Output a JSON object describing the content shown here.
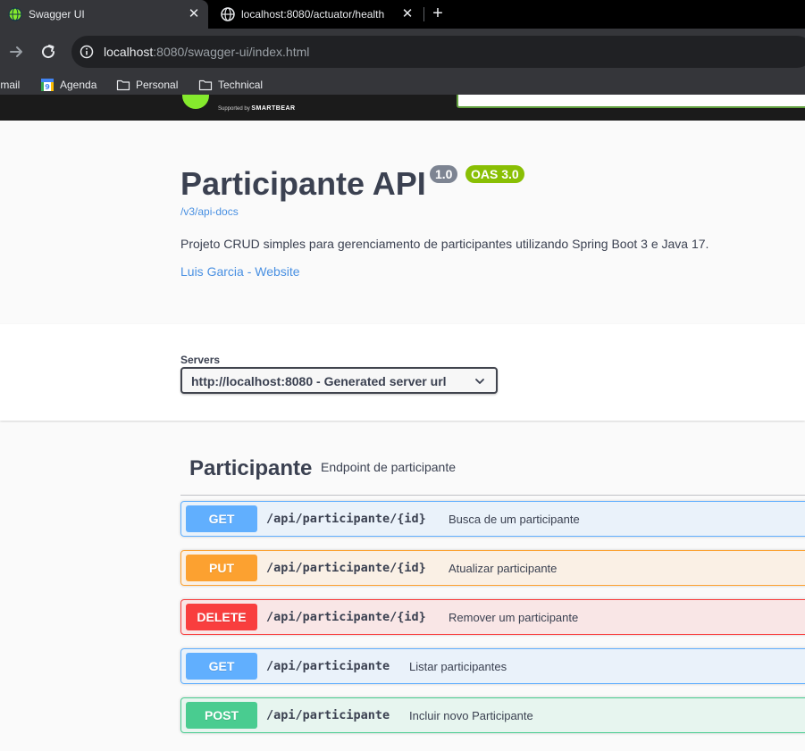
{
  "browser": {
    "tabs": [
      {
        "title": "Swagger UI",
        "active": true,
        "icon": "globe-green-icon"
      },
      {
        "title": "localhost:8080/actuator/health",
        "active": false,
        "icon": "globe-icon"
      }
    ],
    "close_glyph": "✕",
    "new_tab_glyph": "+",
    "address": {
      "host": "localhost",
      "rest": ":8080/swagger-ui/index.html"
    },
    "bookmarks": [
      {
        "label": "Gmail",
        "icon": "gmail-icon"
      },
      {
        "label": "Agenda",
        "icon": "calendar-icon"
      },
      {
        "label": "Personal",
        "icon": "folder-icon"
      },
      {
        "label": "Technical",
        "icon": "folder-icon"
      }
    ]
  },
  "header": {
    "supported_by": "Supported by",
    "brand": "SMARTBEAR"
  },
  "info": {
    "title": "Participante API",
    "version": "1.0",
    "oas_badge": "OAS 3.0",
    "spec_url": "/v3/api-docs",
    "description": "Projeto CRUD simples para gerenciamento de participantes utilizando Spring Boot 3 e Java 17.",
    "contact": "Luis Garcia - Website"
  },
  "servers": {
    "label": "Servers",
    "selected": "http://localhost:8080 - Generated server url"
  },
  "tag": {
    "name": "Participante",
    "description": "Endpoint de participante"
  },
  "operations": [
    {
      "method": "GET",
      "path": "/api/participante/{id}",
      "summary": "Busca de um participante"
    },
    {
      "method": "PUT",
      "path": "/api/participante/{id}",
      "summary": "Atualizar participante"
    },
    {
      "method": "DELETE",
      "path": "/api/participante/{id}",
      "summary": "Remover um participante"
    },
    {
      "method": "GET",
      "path": "/api/participante",
      "summary": "Listar participantes"
    },
    {
      "method": "POST",
      "path": "/api/participante",
      "summary": "Incluir novo Participante"
    }
  ],
  "colors": {
    "get": "#61affe",
    "put": "#fca130",
    "delete": "#f93e3e",
    "post": "#49cc90",
    "version_badge": "#7d8492",
    "oas_badge": "#89bf04",
    "link": "#4990e2"
  }
}
